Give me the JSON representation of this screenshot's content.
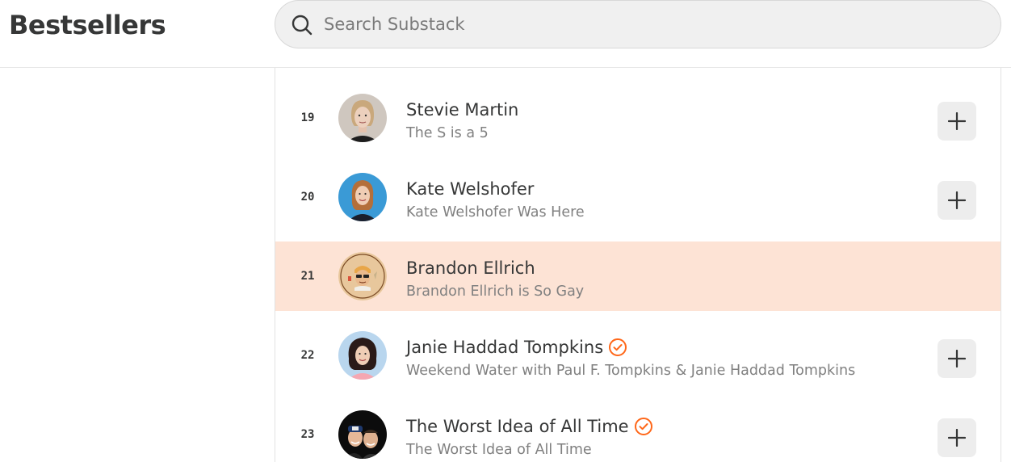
{
  "header": {
    "title": "Bestsellers",
    "search_placeholder": "Search Substack"
  },
  "colors": {
    "accent": "#ff6719",
    "highlight_row": "#fde3d5",
    "button_bg": "#ededed"
  },
  "list": [
    {
      "rank": "19",
      "name": "Stevie Martin",
      "publication": "The S is a 5",
      "verified": false,
      "highlighted": false,
      "follow_icon": "plus-icon"
    },
    {
      "rank": "20",
      "name": "Kate Welshofer",
      "publication": "Kate Welshofer Was Here",
      "verified": false,
      "highlighted": false,
      "follow_icon": "plus-icon"
    },
    {
      "rank": "21",
      "name": "Brandon Ellrich",
      "publication": "Brandon Ellrich is So Gay",
      "verified": false,
      "highlighted": true
    },
    {
      "rank": "22",
      "name": "Janie Haddad Tompkins",
      "publication": "Weekend Water with Paul F. Tompkins & Janie Haddad Tompkins",
      "verified": true,
      "highlighted": false,
      "follow_icon": "plus-icon"
    },
    {
      "rank": "23",
      "name": "The Worst Idea of All Time",
      "publication": "The Worst Idea of All Time",
      "verified": true,
      "highlighted": false,
      "follow_icon": "plus-icon"
    }
  ]
}
